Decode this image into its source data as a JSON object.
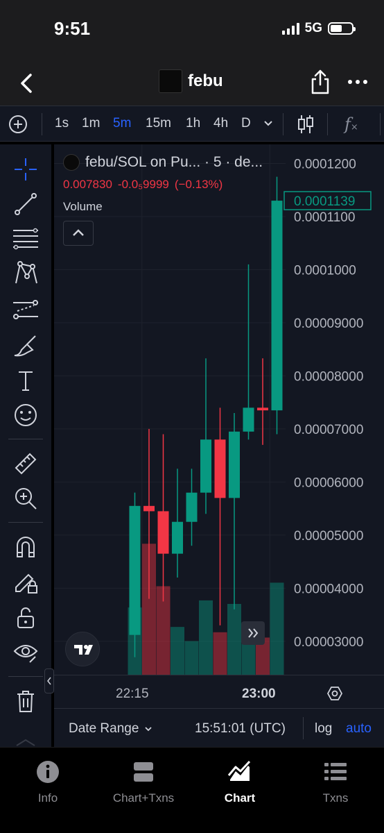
{
  "status_bar": {
    "time": "9:51",
    "network": "5G"
  },
  "nav": {
    "title": "febu",
    "back_icon": "chevron-left-icon",
    "share_icon": "share-icon",
    "more_icon": "more-icon"
  },
  "toolbar": {
    "timeframes": [
      "1s",
      "1m",
      "5m",
      "15m",
      "1h",
      "4h",
      "D"
    ],
    "selected_timeframe": "5m",
    "accent_color": "#2962ff"
  },
  "legend": {
    "symbol": "febu/SOL on Pu... · 5 · de...",
    "last_price": "0.007830",
    "change_abs": "-0.0₅9999",
    "change_pct": "(−0.13%)",
    "volume_label": "Volume"
  },
  "chart_data": {
    "type": "candlestick",
    "up_color": "#089981",
    "down_color": "#f23645",
    "y_ticks": [
      "0.0001200",
      "0.0001100",
      "0.0001000",
      "0.00009000",
      "0.00008000",
      "0.00007000",
      "0.00006000",
      "0.00005000",
      "0.00004000",
      "0.00003000"
    ],
    "y_tick_values": [
      0.00012,
      0.00011,
      0.0001,
      9e-05,
      8e-05,
      7e-05,
      6e-05,
      5e-05,
      4e-05,
      3e-05
    ],
    "ylim": [
      2.37e-05,
      0.0001236
    ],
    "x_labels": [
      "22:15",
      "23:00"
    ],
    "x_label_index": [
      0.5,
      9.5
    ],
    "current_price_label": "0.0001139",
    "candles": [
      {
        "o": 3.12e-05,
        "h": 5.8e-05,
        "l": 2.7e-05,
        "c": 5.55e-05,
        "v": 0.38
      },
      {
        "o": 5.55e-05,
        "h": 7e-05,
        "l": 3.8e-05,
        "c": 5.45e-05,
        "v": 0.74
      },
      {
        "o": 5.45e-05,
        "h": 6.9e-05,
        "l": 3.75e-05,
        "c": 4.65e-05,
        "v": 0.5
      },
      {
        "o": 4.65e-05,
        "h": 6.25e-05,
        "l": 4.2e-05,
        "c": 5.25e-05,
        "v": 0.27
      },
      {
        "o": 5.25e-05,
        "h": 6.25e-05,
        "l": 4.8e-05,
        "c": 5.8e-05,
        "v": 0.19
      },
      {
        "o": 5.8e-05,
        "h": 8.33e-05,
        "l": 5.4e-05,
        "c": 6.8e-05,
        "v": 0.42
      },
      {
        "o": 6.8e-05,
        "h": 7.4e-05,
        "l": 3.3e-05,
        "c": 5.7e-05,
        "v": 0.24
      },
      {
        "o": 5.7e-05,
        "h": 7.3e-05,
        "l": 3.6e-05,
        "c": 6.95e-05,
        "v": 0.4
      },
      {
        "o": 6.95e-05,
        "h": 0.000101,
        "l": 6.8e-05,
        "c": 7.4e-05,
        "v": 0.25
      },
      {
        "o": 7.4e-05,
        "h": 8.33e-05,
        "l": 6.7e-05,
        "c": 7.35e-05,
        "v": 0.21
      },
      {
        "o": 7.35e-05,
        "h": 0.0001175,
        "l": 6.9e-05,
        "c": 0.000113,
        "v": 0.52
      }
    ]
  },
  "time_axis": {
    "left_label": "22:15",
    "right_label": "23:00"
  },
  "bottom_bar": {
    "date_range": "Date Range",
    "clock": "15:51:01 (UTC)",
    "log": "log",
    "auto": "auto"
  },
  "tabs": [
    {
      "label": "Info",
      "icon": "info-icon"
    },
    {
      "label": "Chart+Txns",
      "icon": "split-view-icon"
    },
    {
      "label": "Chart",
      "icon": "chart-icon",
      "active": true
    },
    {
      "label": "Txns",
      "icon": "list-icon"
    }
  ]
}
